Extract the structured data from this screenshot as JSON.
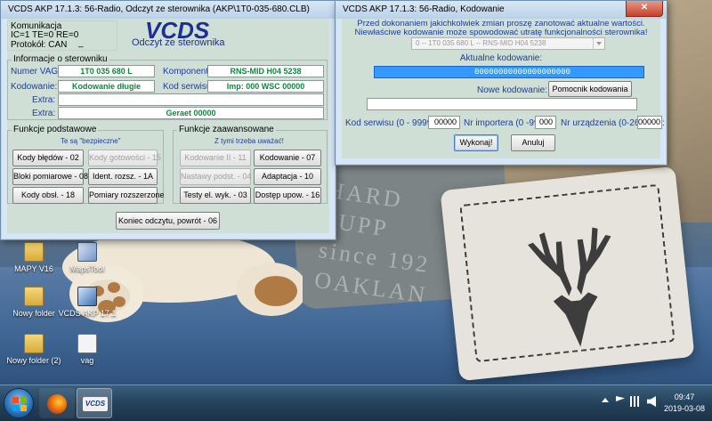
{
  "main_window": {
    "title": "VCDS AKP 17.1.3: 56-Radio,  Odczyt ze sterownika (AKP\\1T0-035-680.CLB)",
    "logo": "VCDS",
    "subtitle": "Odczyt ze sterownika",
    "comm": {
      "label": "Komunikacja",
      "status": "IC=1  TE=0   RE=0",
      "protocol_label": "Protokół: CAN",
      "protocol_value": "_"
    },
    "info": {
      "group_label": "Informacje o sterowniku",
      "vag_label": "Numer VAG:",
      "vag_value": "1T0 035 680 L",
      "component_label": "Komponent:",
      "component_value": "RNS-MID        H04 5238",
      "coding_label": "Kodowanie:",
      "coding_value": "Kodowanie długie",
      "service_label": "Kod serwisu:",
      "service_value": "Imp: 000     WSC 00000",
      "extra1_label": "Extra:",
      "extra1_value": "",
      "extra2_label": "Extra:",
      "extra2_value": "Geraet 00000"
    },
    "basic": {
      "group_label": "Funkcje podstawowe",
      "note": "Te są \"bezpieczne\"",
      "buttons": [
        "Kody błędów - 02",
        "Kody gotowości - 15",
        "Bloki pomiarowe - 08",
        "Ident. rozsz. - 1A",
        "Kody obsł. - 18",
        "Pomiary rozszerzone"
      ]
    },
    "advanced": {
      "group_label": "Funkcje zaawansowane",
      "note": "Z tymi trzeba uważać!",
      "buttons": [
        "Kodowanie II - 11",
        "Kodowanie - 07",
        "Nastawy podst. - 04",
        "Adaptacja - 10",
        "Testy el. wyk. - 03",
        "Dostęp upow. - 16"
      ]
    },
    "end_button": "Koniec odczytu, powrót - 06"
  },
  "coding_dialog": {
    "title": "VCDS AKP 17.1.3: 56-Radio,  Kodowanie",
    "warning_line1": "Przed dokonaniem jakichkolwiek zmian proszę zanotować aktualne wartości.",
    "warning_line2": "Niewłaściwe kodowanie może spowodować utratę funkcjonalności sterownika!",
    "module_select": "0 -- 1T0 035 680 L -- RNS-MID          H04 5238",
    "current_label": "Aktualne kodowanie:",
    "current_value": "00000000000000000000",
    "new_label": "Nowe kodowanie:",
    "new_value": "",
    "helper_button": "Pomocnik kodowania",
    "service_label": "Kod serwisu (0 - 99999):",
    "service_value": "00000",
    "importer_label": "Nr importera (0 -999):",
    "importer_value": "000",
    "device_label": "Nr urządzenia (0-262143):",
    "device_value": "00000",
    "ok_button": "Wykonaj!",
    "cancel_button": "Anuluj"
  },
  "desktop_icons": [
    {
      "label": "MAPY V16",
      "icon": "folder-icon"
    },
    {
      "label": "MapsTool",
      "icon": "app-icon"
    },
    {
      "label": "Nowy folder",
      "icon": "folder-icon"
    },
    {
      "label": "VCDS AKP 17.1",
      "icon": "vcds-icon"
    },
    {
      "label": "Nowy folder (2)",
      "icon": "folder-icon"
    },
    {
      "label": "vag",
      "icon": "document-icon"
    }
  ],
  "taskbar": {
    "time": "09:47",
    "date": "2019-03-08",
    "vcds_label": "VCDS"
  },
  "wallpaper": {
    "cushion_text": "HARD\nSUPP\nsince 192\nOAKLAN"
  }
}
